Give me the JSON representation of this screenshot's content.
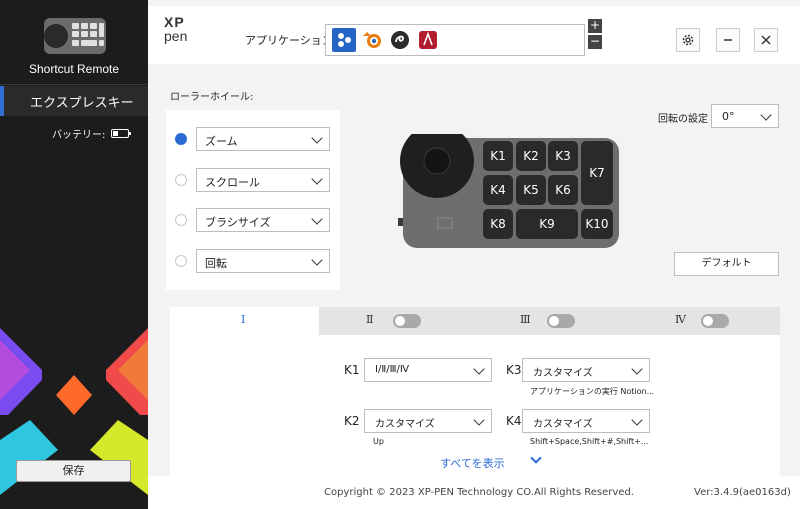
{
  "sidebar": {
    "device_name": "Shortcut Remote",
    "selected_item": "エクスプレスキー",
    "battery_label": "バッテリー:",
    "save_label": "保存"
  },
  "header": {
    "logo_line1": "XP",
    "logo_line2": "pen",
    "applications_label": "アプリケーション:",
    "apps": [
      "global-apps-icon",
      "blender-icon",
      "clip-studio-icon",
      "affinity-icon"
    ],
    "plus": "+",
    "minus": "−"
  },
  "roller": {
    "label": "ローラーホイール:",
    "options": [
      {
        "value": "ズーム",
        "selected": true
      },
      {
        "value": "スクロール",
        "selected": false
      },
      {
        "value": "ブラシサイズ",
        "selected": false
      },
      {
        "value": "回転",
        "selected": false
      }
    ]
  },
  "device_keys": [
    "K1",
    "K2",
    "K3",
    "K7",
    "K4",
    "K5",
    "K6",
    "K8",
    "K9",
    "K10"
  ],
  "rotation": {
    "label": "回転の設定",
    "value": "0°"
  },
  "default_button": "デフォルト",
  "tabs": [
    {
      "label": "Ⅰ",
      "active": true
    },
    {
      "label": "Ⅱ",
      "active": false
    },
    {
      "label": "Ⅲ",
      "active": false
    },
    {
      "label": "Ⅳ",
      "active": false
    }
  ],
  "key_settings": [
    {
      "key": "K1",
      "value": "Ⅰ/Ⅱ/Ⅲ/Ⅳ",
      "sub": ""
    },
    {
      "key": "K3",
      "value": "カスタマイズ",
      "sub": "アプリケーションの実行  Notion..."
    },
    {
      "key": "K2",
      "value": "カスタマイズ",
      "sub": "Up"
    },
    {
      "key": "K4",
      "value": "カスタマイズ",
      "sub": "Shift+Space,Shift+#,Shift+..."
    }
  ],
  "show_all": "すべてを表示",
  "footer": {
    "copyright": "Copyright © 2023  XP-PEN Technology CO.All Rights Reserved.",
    "version": "Ver:3.4.9(ae0163d)"
  },
  "colors": {
    "accent": "#2a6bd4",
    "sidebar_bg": "#1c1c1c"
  }
}
